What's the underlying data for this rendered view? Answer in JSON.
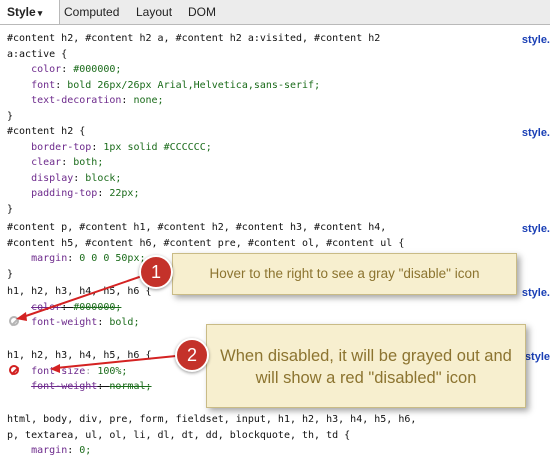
{
  "tabs": [
    {
      "label": "Style",
      "caret": "▾"
    },
    {
      "label": "Computed"
    },
    {
      "label": "Layout"
    },
    {
      "label": "DOM"
    }
  ],
  "rules": [
    {
      "selector": "#content h2, #content h2 a, #content h2 a:visited, #content h2\na:active {",
      "source": "style.",
      "declarations": [
        {
          "prop": "color",
          "value": "#000000;"
        },
        {
          "prop": "font",
          "value": "bold 26px/26px Arial,Helvetica,sans-serif;"
        },
        {
          "prop": "text-decoration",
          "value": "none;"
        }
      ],
      "close": "}"
    },
    {
      "selector": "#content h2 {",
      "source": "style.",
      "declarations": [
        {
          "prop": "border-top",
          "value": "1px solid #CCCCCC;"
        },
        {
          "prop": "clear",
          "value": "both;"
        },
        {
          "prop": "display",
          "value": "block;"
        },
        {
          "prop": "padding-top",
          "value": "22px;"
        }
      ],
      "close": "}"
    },
    {
      "selector": "#content p, #content h1, #content h2, #content h3, #content h4,\n#content h5, #content h6, #content pre, #content ol, #content ul {",
      "source": "style.",
      "declarations": [
        {
          "prop": "margin",
          "value": "0 0 0 50px;"
        }
      ],
      "close": "}"
    },
    {
      "selector": "h1, h2, h3, h4, h5, h6 {",
      "source": "style.",
      "declarations": [
        {
          "prop": "color",
          "value": "#000000;"
        },
        {
          "prop": "font-weight",
          "value": "bold;"
        }
      ]
    },
    {
      "selector": "h1, h2, h3, h4, h5, h6 {",
      "source": "style",
      "declarations": [
        {
          "prop": "font-size",
          "value": "100%;"
        },
        {
          "prop": "font-weight",
          "value": "normal;"
        }
      ]
    },
    {
      "selector": "html, body, div, pre, form, fieldset, input, h1, h2, h3, h4, h5, h6,\np, textarea, ul, ol, li, dl, dt, dd, blockquote, th, td {",
      "declarations": [
        {
          "prop": "margin",
          "value": "0;"
        }
      ]
    }
  ],
  "callouts": [
    {
      "number": "1",
      "text": "Hover to the right to see a gray \"disable\" icon"
    },
    {
      "number": "2",
      "text": "When disabled, it will be grayed out and will show a red \"disabled\" icon"
    }
  ],
  "colors": {
    "badge": "#c4322a",
    "callout_bg": "#f7efcf",
    "callout_text": "#8c7430",
    "source_link": "#1a3fb5",
    "disable_icon": "#b5b5b5",
    "disabled_icon": "#d22020"
  },
  "icons": [
    "disable-icon",
    "disabled-icon"
  ]
}
